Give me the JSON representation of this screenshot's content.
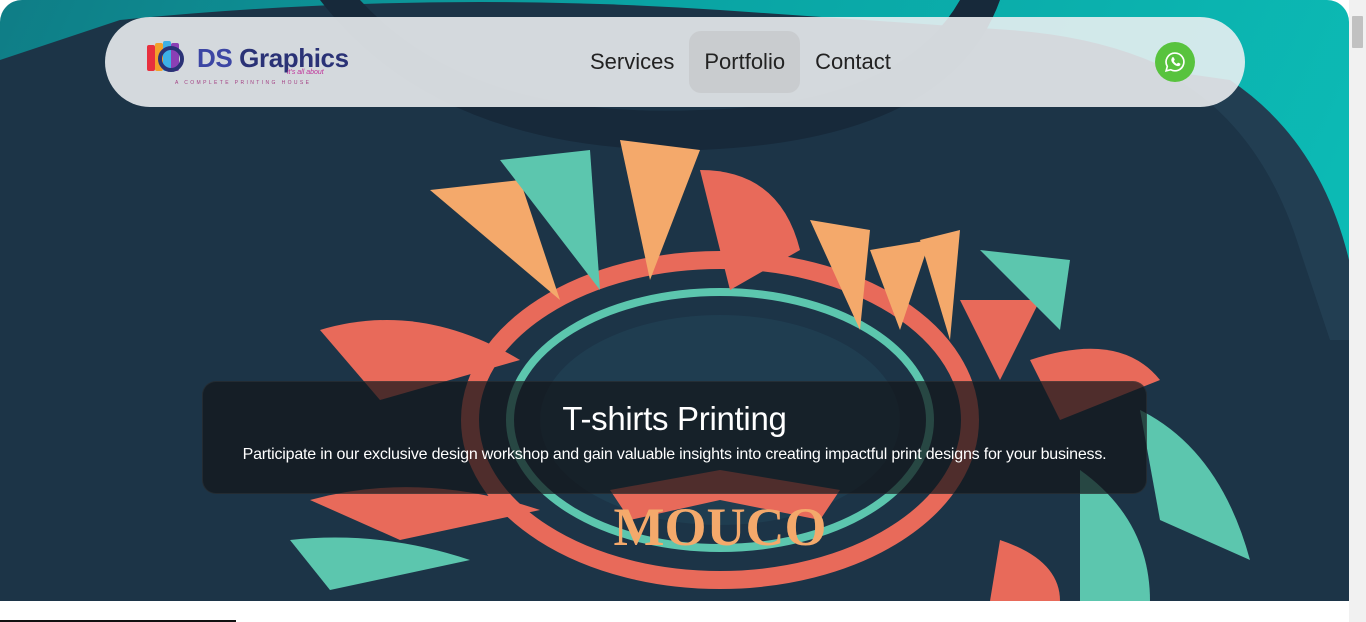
{
  "brand": {
    "name_prefix": "DS",
    "name_suffix": "Graphics",
    "script": "it's all about",
    "tagline": "A COMPLETE PRINTING HOUSE"
  },
  "nav": {
    "items": [
      {
        "label": "Services",
        "active": false
      },
      {
        "label": "Portfolio",
        "active": true
      },
      {
        "label": "Contact",
        "active": false
      }
    ]
  },
  "hero": {
    "shirt_print_text": "MOUCO",
    "title": "T-shirts Printing",
    "description": "Participate in our exclusive design workshop and gain valuable insights into creating impactful print designs for your business."
  },
  "icons": {
    "whatsapp": "whatsapp-icon",
    "logo": "logo-icon"
  },
  "colors": {
    "whatsapp_green": "#58c33e",
    "brand_navy": "#2a3276",
    "teal_background": "#0cc0b9",
    "shirt_navy": "#1d3a4c",
    "print_coral": "#e86a5a",
    "print_mint": "#5cc6ae",
    "print_peach": "#f4a96b"
  }
}
